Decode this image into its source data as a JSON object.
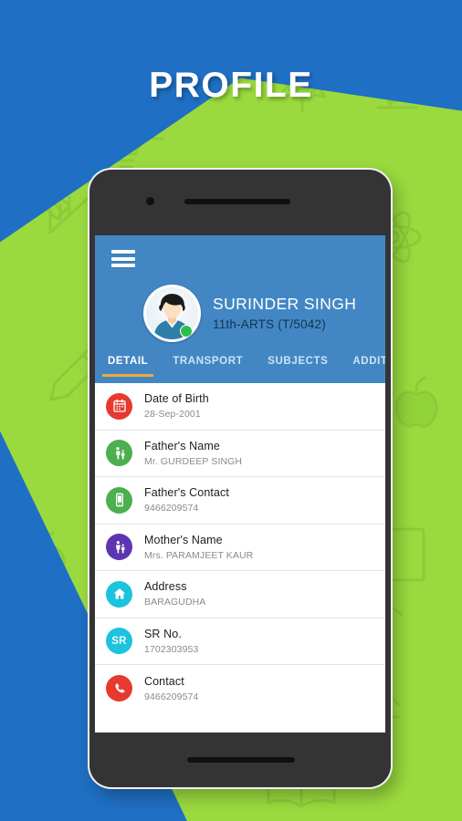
{
  "poster": {
    "title": "PROFILE",
    "background_color": "#1f6fc4",
    "accent_color": "#9ada3e"
  },
  "app": {
    "header": {
      "background_color": "#4287c4",
      "menu_icon": "hamburger-menu-icon",
      "avatar_icon": "user-avatar-icon",
      "avatar_badge_icon": "online-badge-icon",
      "name": "SURINDER SINGH",
      "class_info": "11th-ARTS (T/5042)"
    },
    "tabs": [
      {
        "label": "DETAIL",
        "active": true
      },
      {
        "label": "TRANSPORT",
        "active": false
      },
      {
        "label": "SUBJECTS",
        "active": false
      },
      {
        "label": "ADDITIONAL",
        "active": false
      }
    ],
    "tab_indicator_color": "#f0a93b",
    "detail_items": [
      {
        "label": "Date of Birth",
        "value": "28-Sep-2001",
        "icon": "calendar-icon",
        "icon_color": "#e8392e"
      },
      {
        "label": "Father's Name",
        "value": "Mr. GURDEEP SINGH",
        "icon": "father-icon",
        "icon_color": "#4caf50"
      },
      {
        "label": "Father's Contact",
        "value": "9466209574",
        "icon": "mobile-phone-icon",
        "icon_color": "#4caf50"
      },
      {
        "label": "Mother's Name",
        "value": "Mrs. PARAMJEET KAUR",
        "icon": "mother-icon",
        "icon_color": "#5e35b1"
      },
      {
        "label": "Address",
        "value": "BARAGUDHA",
        "icon": "home-icon",
        "icon_color": "#1cc3dd"
      },
      {
        "label": "SR No.",
        "value": "1702303953",
        "icon": "sr-text-icon",
        "icon_color": "#1cc3dd"
      },
      {
        "label": "Contact",
        "value": "9466209574",
        "icon": "phone-handset-icon",
        "icon_color": "#e8392e"
      }
    ]
  }
}
